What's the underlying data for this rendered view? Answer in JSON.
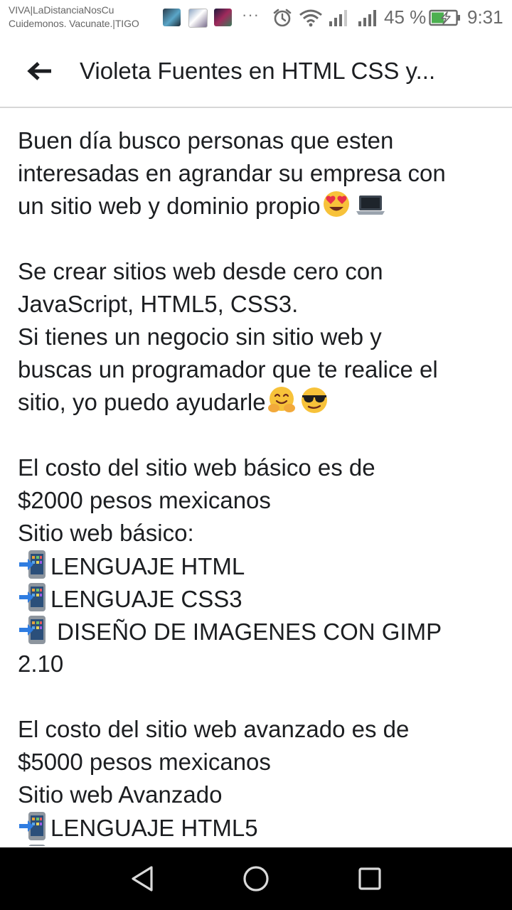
{
  "status_bar": {
    "carrier_line1": "VIVA|LaDistanciaNosCu",
    "carrier_line2": "Cuidemonos. Vacunate.|TIGO",
    "more_icon": "···",
    "battery_percent": "45 %",
    "time": "9:31"
  },
  "app_bar": {
    "title": "Violeta Fuentes en HTML CSS y..."
  },
  "post": {
    "lines": [
      "Buen día busco personas que esten",
      "interesadas en agrandar su empresa con",
      "un sitio web y dominio propio",
      "Se crear sitios web desde cero  con",
      "JavaScript, HTML5, CSS3.",
      "Si tienes un negocio sin sitio web y",
      "buscas un programador que te realice el",
      "sitio, yo puedo ayudarle",
      "El costo del sitio web básico es de",
      "$2000 pesos mexicanos",
      "Sitio web básico:",
      "LENGUAJE HTML",
      "LENGUAJE CSS3",
      " DISEÑO DE IMAGENES CON GIMP",
      "2.10",
      "El costo del sitio web avanzado es de",
      "$5000 pesos mexicanos",
      "Sitio web Avanzado",
      "LENGUAJE HTML5"
    ]
  },
  "icons": {
    "back": "arrow-left-icon",
    "alarm": "alarm-clock-icon",
    "wifi": "wifi-icon",
    "signal": "cell-signal-icon",
    "battery": "battery-charging-icon",
    "heart_eyes": "heart-eyes-emoji",
    "laptop": "laptop-emoji",
    "hugging": "hugging-face-emoji",
    "sunglasses": "sunglasses-emoji",
    "phone_arrow": "mobile-phone-arrow-emoji",
    "nav_back": "triangle-back-icon",
    "nav_home": "circle-home-icon",
    "nav_recents": "square-recents-icon"
  },
  "colors": {
    "text": "#1c1e21",
    "status_grey": "#6b6b6b",
    "battery_green": "#4caf50",
    "navbar_bg": "#000000",
    "divider": "#d7d7d7"
  }
}
